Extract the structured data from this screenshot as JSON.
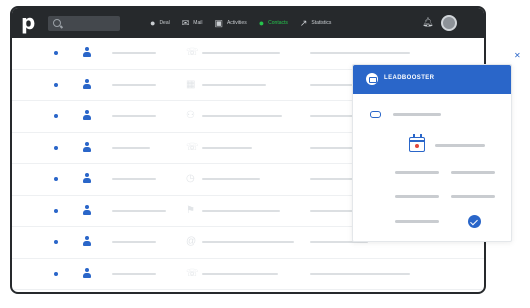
{
  "app": {
    "logo_text": "p",
    "search_icon": "search-icon"
  },
  "nav": {
    "items": [
      {
        "label": "Deal",
        "icon": "dollar-circle-icon"
      },
      {
        "label": "Mail",
        "icon": "mail-icon"
      },
      {
        "label": "Activities",
        "icon": "calendar-icon"
      },
      {
        "label": "Contacts",
        "icon": "person-icon",
        "active": true
      },
      {
        "label": "Statistics",
        "icon": "trend-line-icon"
      }
    ]
  },
  "panel": {
    "title": "LEADBOOSTER"
  },
  "colors": {
    "topbar": "#26292c",
    "accent": "#2a66c9",
    "active_nav": "#25c44c"
  }
}
